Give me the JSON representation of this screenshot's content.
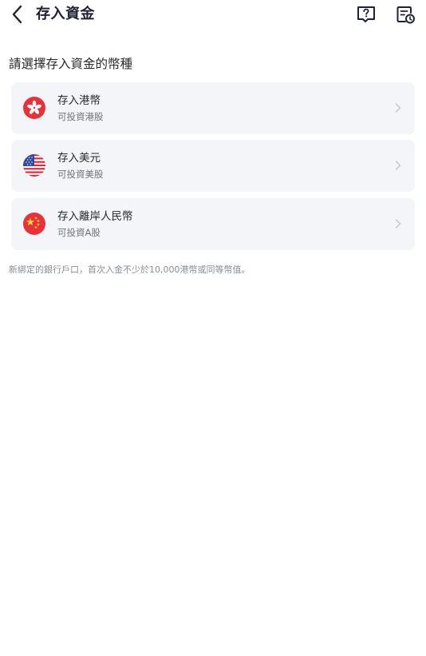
{
  "header": {
    "title": "存入資金",
    "back_icon": "chevron-left-icon",
    "help_icon": "question-message-icon",
    "records_icon": "document-clock-icon",
    "icon_color": "#1f2233"
  },
  "section_title": "請選擇存入資金的幣種",
  "currencies": [
    {
      "title": "存入港幣",
      "subtitle": "可投資港股",
      "flag_icon": "hong-kong-flag-icon"
    },
    {
      "title": "存入美元",
      "subtitle": "可投資美股",
      "flag_icon": "us-flag-icon"
    },
    {
      "title": "存入離岸人民幣",
      "subtitle": "可投資A股",
      "flag_icon": "china-flag-icon"
    }
  ],
  "footnote": "新綁定的銀行戶口，首次入金不少於10,000港幣或同等幣值。",
  "colors": {
    "card_background": "#f4f5f8",
    "flag_red": "#e8313a",
    "chevron": "#c4c6cc"
  }
}
